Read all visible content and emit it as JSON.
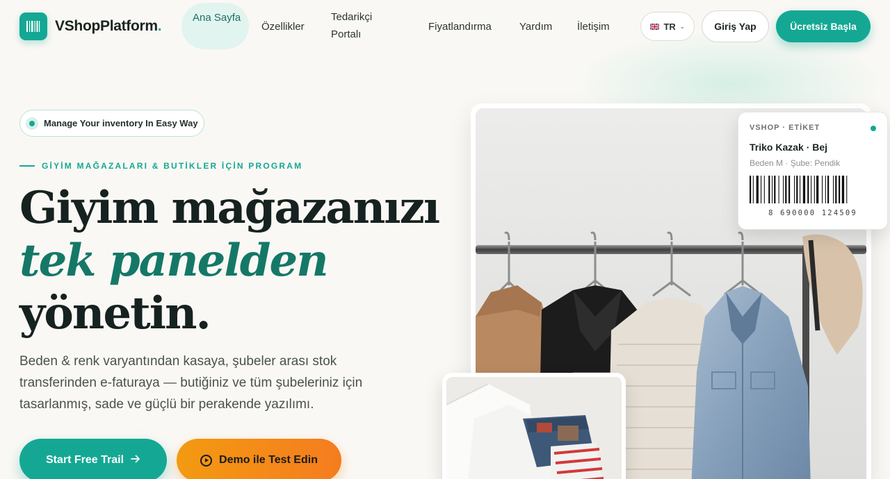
{
  "brand": {
    "name": "VShopPlatform",
    "dot": ".",
    "accent_color": "#14a894"
  },
  "nav": {
    "home_label": "Ana Sayfa",
    "items": [
      "Özellikler",
      "Tedarikçi Portalı",
      "Fiyatlandırma",
      "Yardım",
      "İletişim"
    ],
    "language": "TR",
    "login_label": "Giriş Yap",
    "start_label": "Ücretsiz Başla"
  },
  "hero": {
    "pill_text": "Manage Your inventory In Easy Way",
    "eyebrow": "GİYİM MAĞAZALARI & BUTİKLER İÇİN PROGRAM",
    "headline_line1": "Giyim mağazanızı",
    "headline_accent": "tek panelden",
    "headline_line3": "yönetin.",
    "lead": "Beden & renk varyantından kasaya, şubeler arası stok transferinden e-faturaya — butiğiniz ve tüm şubeleriniz için tasarlanmış, sade ve güçlü bir perakende yazılımı.",
    "cta_primary": "Start Free Trail",
    "cta_secondary": "Demo ile Test Edin",
    "secondary_color": "#f5891a"
  },
  "label_card": {
    "tag": "VSHOP · ETİKET",
    "product": "Triko Kazak · Bej",
    "details": "Beden M · Şube: Pendik",
    "barcode_number": "8 690000 124509"
  }
}
